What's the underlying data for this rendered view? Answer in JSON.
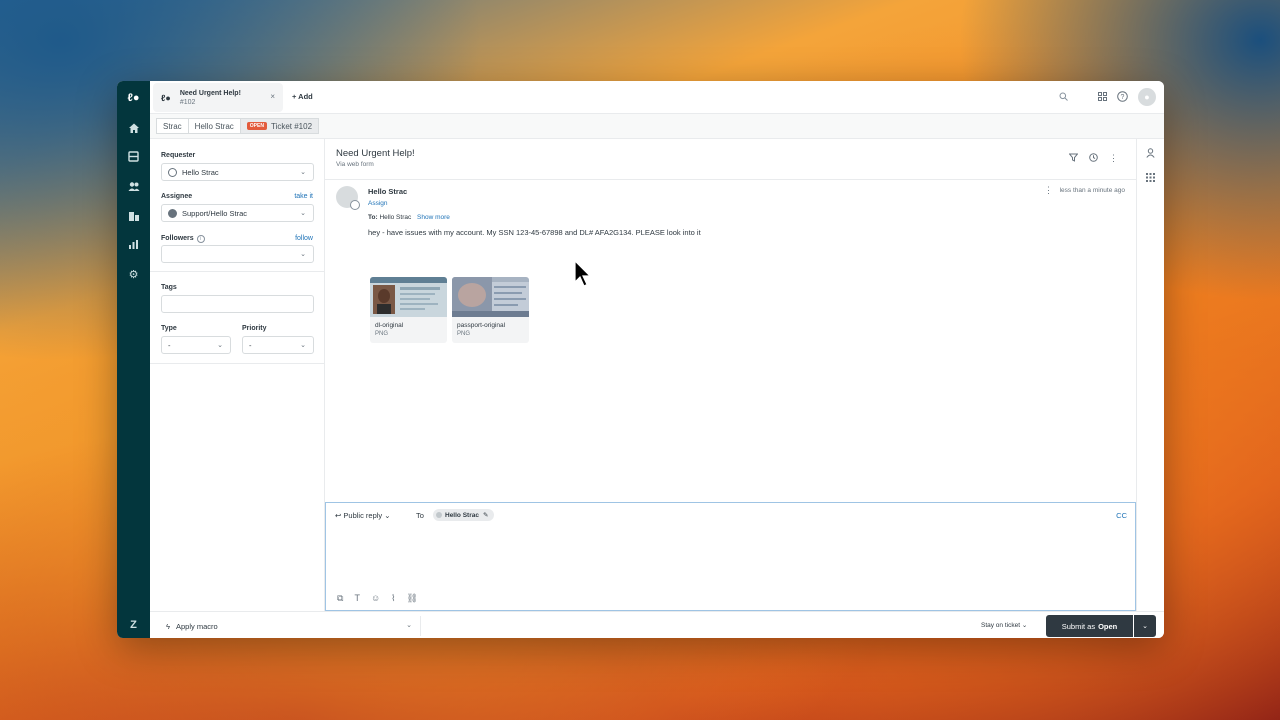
{
  "tab": {
    "title": "Need Urgent Help!",
    "number": "#102",
    "close": "×",
    "add_label": "+ Add"
  },
  "breadcrumb": [
    "Strac",
    "Hello Strac",
    "Ticket #102"
  ],
  "status_badge": "OPEN",
  "sidebar": {
    "requester_label": "Requester",
    "requester_value": "Hello Strac",
    "assignee_label": "Assignee",
    "take_it": "take it",
    "assignee_value": "Support/Hello Strac",
    "followers_label": "Followers",
    "follow": "follow",
    "tags_label": "Tags",
    "type_label": "Type",
    "type_value": "-",
    "priority_label": "Priority",
    "priority_value": "-"
  },
  "ticket": {
    "title": "Need Urgent Help!",
    "via": "Via web form"
  },
  "message": {
    "author": "Hello Strac",
    "assign": "Assign",
    "to_prefix": "To:",
    "to_name": "Hello Strac",
    "show_more": "Show more",
    "time": "less than a minute ago",
    "body": "hey - have issues with my account. My SSN 123-45-67898 and DL# AFA2G134. PLEASE look into it"
  },
  "attachments": [
    {
      "name": "dl-original",
      "type": "PNG"
    },
    {
      "name": "passport-original",
      "type": "PNG"
    }
  ],
  "reply": {
    "type": "Public reply",
    "to": "To",
    "recipient": "Hello Strac",
    "cc": "CC"
  },
  "footer": {
    "macro": "Apply macro",
    "stay": "Stay on ticket",
    "submit_prefix": "Submit as",
    "submit_status": "Open"
  },
  "colors": {
    "rail": "#03363d",
    "link": "#1f73b7",
    "submit": "#2f3941",
    "badge": "#e35b3c"
  }
}
